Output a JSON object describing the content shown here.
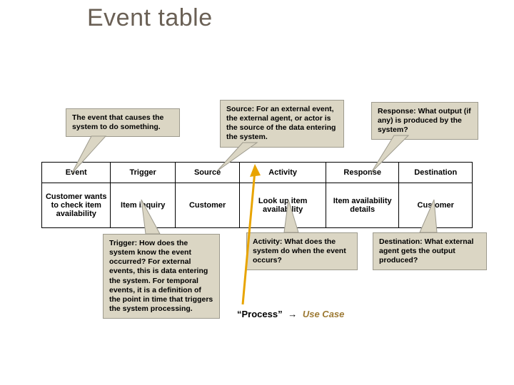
{
  "title": "Event table",
  "callouts": {
    "event": "The event that causes the system to do something.",
    "source": "Source: For an external event, the external agent, or actor is the source of the data entering the system.",
    "response": "Response: What output (if any) is produced by the system?",
    "trigger": "Trigger: How does the system know the event occurred? For external events, this is data entering the system. For temporal events, it is a definition of the point in time that triggers the system processing.",
    "activity": "Activity: What does the system do when the event occurs?",
    "destination": "Destination: What external agent gets the output produced?"
  },
  "table": {
    "headers": [
      "Event",
      "Trigger",
      "Source",
      "Activity",
      "Response",
      "Destination"
    ],
    "row": [
      "Customer wants to check item availability",
      "Item inquiry",
      "Customer",
      "Look up item availability",
      "Item availability details",
      "Customer"
    ]
  },
  "footer": {
    "left": "“Process”",
    "arrow": "→",
    "right": "Use Case"
  }
}
